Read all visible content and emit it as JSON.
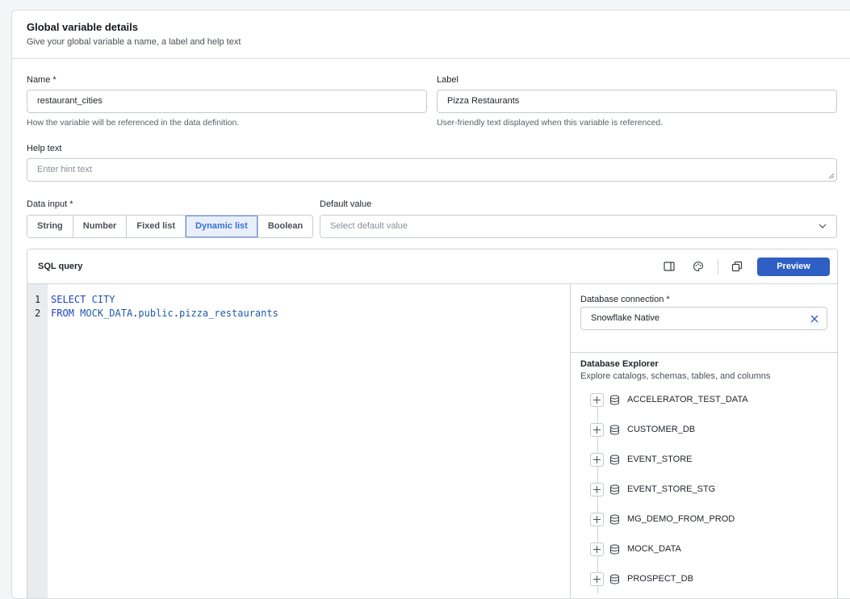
{
  "header": {
    "title": "Global variable details",
    "subtitle": "Give your global variable a name, a label and help text"
  },
  "form": {
    "name_label": "Name *",
    "name_value": "restaurant_cities",
    "name_hint": "How the variable will be referenced in the data definition.",
    "label_label": "Label",
    "label_value": "Pizza Restaurants",
    "label_hint": "User-friendly text displayed when this variable is referenced.",
    "help_label": "Help text",
    "help_placeholder": "Enter hint text",
    "data_input_label": "Data input *",
    "data_input_options": [
      "String",
      "Number",
      "Fixed list",
      "Dynamic list",
      "Boolean"
    ],
    "data_input_selected": "Dynamic list",
    "default_label": "Default value",
    "default_placeholder": "Select default value"
  },
  "sql": {
    "title": "SQL query",
    "preview_label": "Preview",
    "line_numbers": [
      "1",
      "2"
    ],
    "line1": {
      "kw": "SELECT",
      "rest": "CITY"
    },
    "line2": {
      "kw": "FROM",
      "db": "MOCK_DATA",
      "dot1": ".",
      "schema": "public",
      "dot2": ".",
      "table": "pizza_restaurants"
    }
  },
  "connection": {
    "label": "Database connection *",
    "value": "Snowflake Native"
  },
  "explorer": {
    "title": "Database Explorer",
    "subtitle": "Explore catalogs, schemas, tables, and columns",
    "items": [
      "ACCELERATOR_TEST_DATA",
      "CUSTOMER_DB",
      "EVENT_STORE",
      "EVENT_STORE_STG",
      "MG_DEMO_FROM_PROD",
      "MOCK_DATA",
      "PROSPECT_DB"
    ]
  },
  "colors": {
    "accent": "#2f5ec4",
    "selected_bg": "#e8effb",
    "keyword": "#1e3fc2"
  }
}
